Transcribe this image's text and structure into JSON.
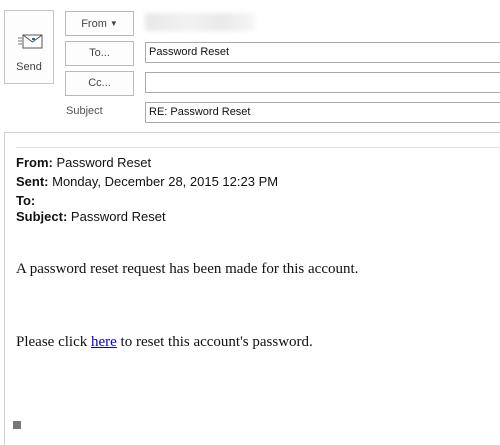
{
  "toolbar": {
    "send_label": "Send",
    "from_label": "From",
    "to_label": "To...",
    "cc_label": "Cc..."
  },
  "header": {
    "to_value": "Password Reset",
    "cc_value": "",
    "subject_label": "Subject",
    "subject_value": "RE: Password Reset"
  },
  "quoted": {
    "from_label": "From:",
    "from_value": "Password Reset",
    "sent_label": "Sent:",
    "sent_value": "Monday, December 28, 2015 12:23 PM",
    "to_label": "To:",
    "to_value": "",
    "subject_label": "Subject:",
    "subject_value": "Password Reset"
  },
  "message": {
    "line1": "A password reset request has been made for this account.",
    "line2_before": "Please click ",
    "link_text": "here",
    "line2_after": " to reset this account's password."
  },
  "icons": {
    "send": "envelope-send-icon",
    "from_dropdown": "chevron-down-icon",
    "resize": "resize-handle-icon"
  },
  "colors": {
    "link": "#0000cc",
    "border": "#b9b9b9"
  }
}
